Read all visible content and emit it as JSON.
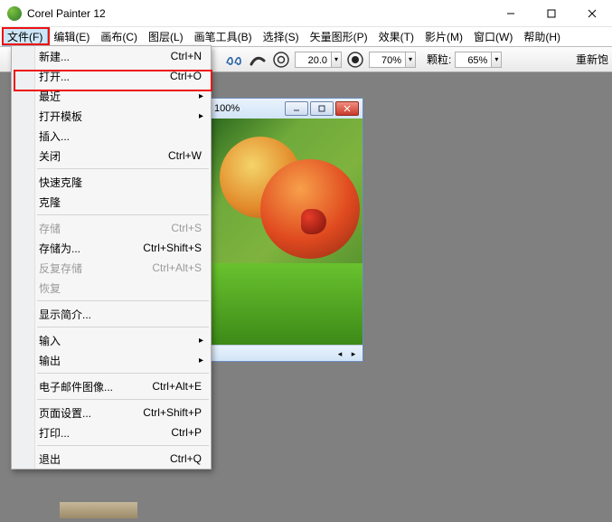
{
  "title": "Corel Painter 12",
  "menubar": [
    {
      "label": "文件(F)",
      "active": true
    },
    {
      "label": "编辑(E)"
    },
    {
      "label": "画布(C)"
    },
    {
      "label": "图层(L)"
    },
    {
      "label": "画笔工具(B)"
    },
    {
      "label": "选择(S)"
    },
    {
      "label": "矢量图形(P)"
    },
    {
      "label": "效果(T)"
    },
    {
      "label": "影片(M)"
    },
    {
      "label": "窗口(W)"
    },
    {
      "label": "帮助(H)"
    }
  ],
  "toolbar": {
    "size_value": "20.0",
    "opacity_value": "70%",
    "grain_label": "颗粒:",
    "grain_value": "65%",
    "resat_label": "重新饱"
  },
  "doc": {
    "zoom": "100%"
  },
  "file_menu": [
    {
      "label": "新建...",
      "shortcut": "Ctrl+N"
    },
    {
      "label": "打开...",
      "shortcut": "Ctrl+O",
      "highlight": true
    },
    {
      "label": "最近",
      "submenu": true
    },
    {
      "label": "打开模板",
      "submenu": true
    },
    {
      "label": "插入..."
    },
    {
      "label": "关闭",
      "shortcut": "Ctrl+W"
    },
    {
      "sep": true
    },
    {
      "label": "快速克隆"
    },
    {
      "label": "克隆"
    },
    {
      "sep": true
    },
    {
      "label": "存储",
      "shortcut": "Ctrl+S",
      "disabled": true
    },
    {
      "label": "存储为...",
      "shortcut": "Ctrl+Shift+S"
    },
    {
      "label": "反复存储",
      "shortcut": "Ctrl+Alt+S",
      "disabled": true
    },
    {
      "label": "恢复",
      "disabled": true
    },
    {
      "sep": true
    },
    {
      "label": "显示简介..."
    },
    {
      "sep": true
    },
    {
      "label": "输入",
      "submenu": true
    },
    {
      "label": "输出",
      "submenu": true
    },
    {
      "sep": true
    },
    {
      "label": "电子邮件图像...",
      "shortcut": "Ctrl+Alt+E"
    },
    {
      "sep": true
    },
    {
      "label": "页面设置...",
      "shortcut": "Ctrl+Shift+P"
    },
    {
      "label": "打印...",
      "shortcut": "Ctrl+P"
    },
    {
      "sep": true
    },
    {
      "label": "退出",
      "shortcut": "Ctrl+Q"
    }
  ]
}
